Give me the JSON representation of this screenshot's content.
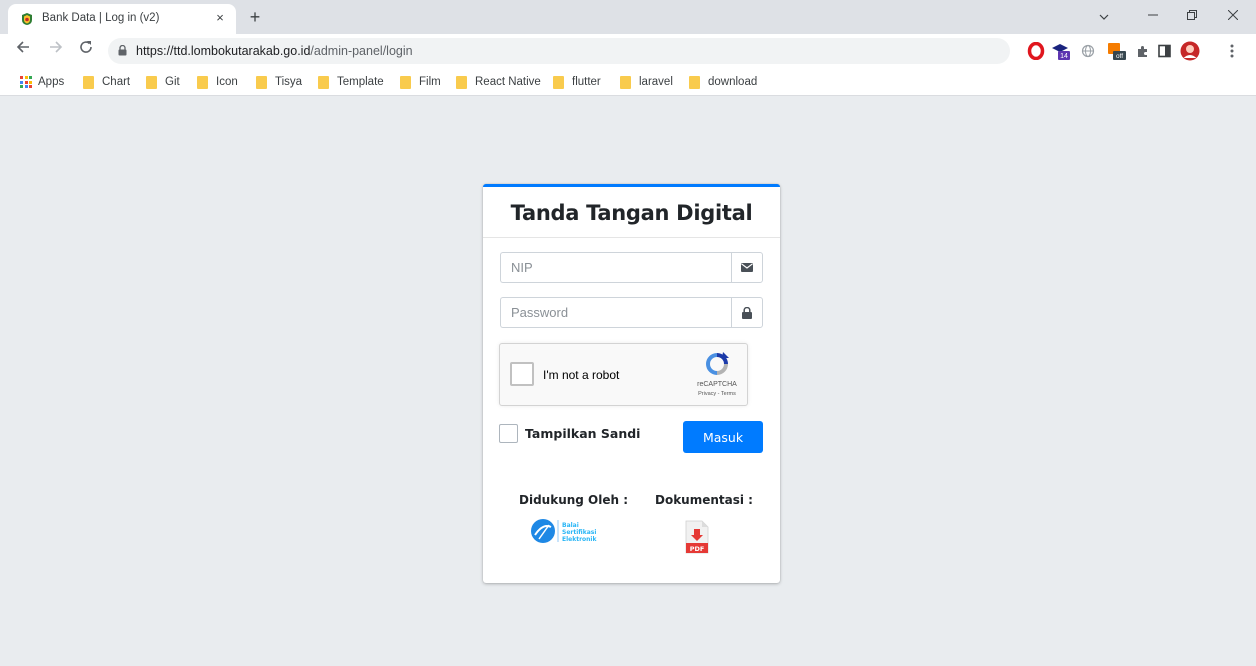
{
  "browser": {
    "tab_title": "Bank Data | Log in (v2)",
    "tab_close": "×",
    "new_tab": "+",
    "url_host": "https://ttd.lombokutarakab.go.id",
    "url_path": "/admin-panel/login",
    "bookmarks": [
      "Apps",
      "Chart",
      "Git",
      "Icon",
      "Tisya",
      "Template",
      "Film",
      "React Native",
      "flutter",
      "laravel",
      "download"
    ],
    "extension_badge_1": "14",
    "extension_badge_2": "off",
    "colors": {
      "accent": "#007bff",
      "folder": "#f9cb4d",
      "page_bg": "#e9ecef"
    }
  },
  "login": {
    "title": "Tanda Tangan Digital",
    "nip_placeholder": "NIP",
    "password_placeholder": "Password",
    "recaptcha": {
      "label": "I'm not a robot",
      "brand": "reCAPTCHA",
      "terms": "Privacy - Terms"
    },
    "show_password_label": "Tampilkan Sandi",
    "submit_label": "Masuk",
    "supported_by_label": "Didukung Oleh :",
    "documentation_label": "Dokumentasi :",
    "bse_logo_text": "Balai Sertifikasi Elektronik",
    "pdf_label": "PDF"
  }
}
